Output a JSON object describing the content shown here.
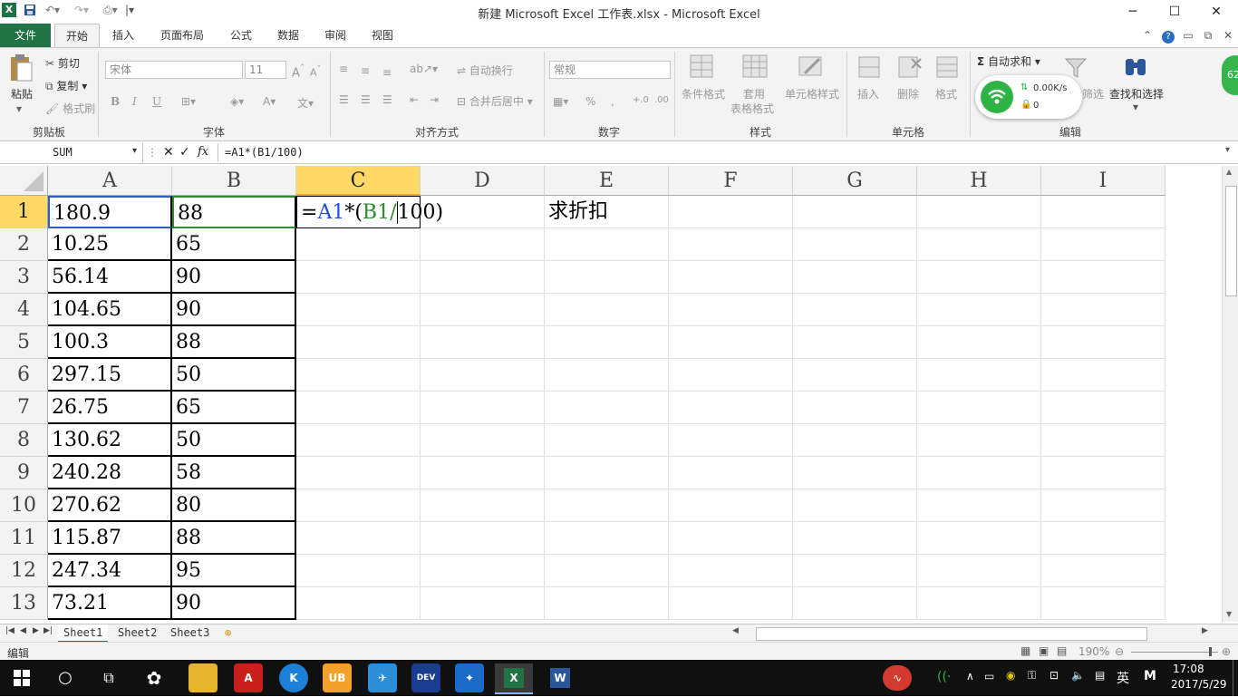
{
  "window": {
    "title": "新建 Microsoft Excel 工作表.xlsx - Microsoft Excel",
    "app_icon": "X",
    "controls": [
      "─",
      "☐",
      "✕"
    ]
  },
  "tabs": [
    "文件",
    "开始",
    "插入",
    "页面布局",
    "公式",
    "数据",
    "审阅",
    "视图"
  ],
  "active_tab": "开始",
  "ribbon": {
    "clipboard": {
      "paste": "粘贴",
      "cut": "剪切",
      "copy": "复制",
      "format_painter": "格式刷",
      "label": "剪贴板"
    },
    "font": {
      "name": "宋体",
      "size": "11",
      "bold": "B",
      "italic": "I",
      "underline": "U",
      "label": "字体"
    },
    "alignment": {
      "wrap": "自动换行",
      "merge": "合并后居中",
      "label": "对齐方式"
    },
    "number": {
      "format": "常规",
      "percent": "%",
      "comma": ",",
      "label": "数字"
    },
    "styles": {
      "conditional": "条件格式",
      "table1": "套用",
      "table2": "表格格式",
      "cell_styles": "单元格样式",
      "label": "样式"
    },
    "cells": {
      "insert": "插入",
      "delete": "删除",
      "format": "格式",
      "label": "单元格"
    },
    "editing": {
      "autosum": "自动求和",
      "filter": "筛选",
      "find": "查找和选择",
      "label": "编辑"
    }
  },
  "wifi_widget": {
    "speed": "0.00K/s",
    "count": "0",
    "badge": "62"
  },
  "formula_bar": {
    "name_box": "SUM",
    "fx": "fx",
    "formula": "=A1*(B1/100)"
  },
  "columns": [
    "A",
    "B",
    "C",
    "D",
    "E",
    "F",
    "G",
    "H",
    "I"
  ],
  "rows": [
    {
      "n": "1",
      "a": "180.9",
      "b": "88"
    },
    {
      "n": "2",
      "a": "10.25",
      "b": "65"
    },
    {
      "n": "3",
      "a": "56.14",
      "b": "90"
    },
    {
      "n": "4",
      "a": "104.65",
      "b": "90"
    },
    {
      "n": "5",
      "a": "100.3",
      "b": "88"
    },
    {
      "n": "6",
      "a": "297.15",
      "b": "50"
    },
    {
      "n": "7",
      "a": "26.75",
      "b": "65"
    },
    {
      "n": "8",
      "a": "130.62",
      "b": "50"
    },
    {
      "n": "9",
      "a": "240.28",
      "b": "58"
    },
    {
      "n": "10",
      "a": "270.62",
      "b": "80"
    },
    {
      "n": "11",
      "a": "115.87",
      "b": "88"
    },
    {
      "n": "12",
      "a": "247.34",
      "b": "95"
    },
    {
      "n": "13",
      "a": "73.21",
      "b": "90"
    }
  ],
  "editing_cell": {
    "ref": "C1",
    "parts": [
      {
        "text": "=",
        "color": "#000000"
      },
      {
        "text": "A1",
        "color": "#1f4fd8"
      },
      {
        "text": "*(",
        "color": "#000000"
      },
      {
        "text": "B1",
        "color": "#2e8b2e"
      },
      {
        "text": "/",
        "color": "#2e8b2e"
      },
      {
        "text": "100)",
        "color": "#000000"
      }
    ]
  },
  "e1_text": "求折扣",
  "sheets": [
    "Sheet1",
    "Sheet2",
    "Sheet3"
  ],
  "active_sheet": "Sheet1",
  "status": {
    "mode": "编辑",
    "zoom": "190%"
  },
  "taskbar": {
    "clock_time": "17:08",
    "clock_date": "2017/5/29",
    "ime": "英",
    "ime2": "M",
    "apps": [
      "start",
      "search",
      "task-view",
      "pinwheel",
      "file-explorer",
      "pdf",
      "k",
      "ub",
      "bird",
      "dev",
      "tool",
      "excel",
      "word"
    ]
  },
  "colors": {
    "excel_green": "#217346",
    "header_selected": "#ffd966"
  }
}
